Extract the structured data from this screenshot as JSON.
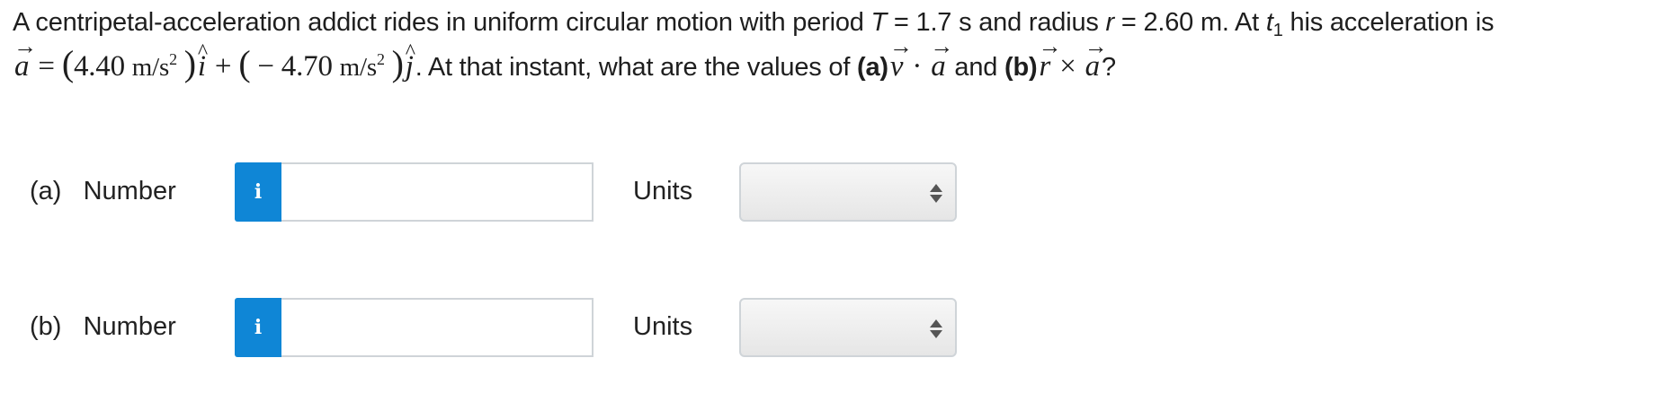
{
  "problem": {
    "text1": "A centripetal-acceleration addict rides in uniform circular motion with period ",
    "period_var": "T",
    "period_value": " = 1.7 s and radius ",
    "radius_var": "r",
    "radius_value": " = 2.60 m. At ",
    "time_var": "t",
    "time_sub": "1",
    "text2": " his acceleration is",
    "accel_vec": "a",
    "eq": " = ",
    "x_comp": "4.40",
    "y_comp": "− 4.70",
    "unit": "m/s",
    "unit_exp": "2",
    "i_hat": "i",
    "j_hat": "j",
    "plus": " + ",
    "question_lead": ". At that instant, what are the values of ",
    "part_a_label": "(a)",
    "v_vec": "v",
    "dot": " · ",
    "and": " and ",
    "part_b_label": "(b)",
    "r_vec": "r",
    "cross": " × ",
    "question_end": "?"
  },
  "answers": [
    {
      "label": "(a)   Number",
      "info_icon": "i",
      "value": "",
      "units_label": "Units",
      "units_selected": ""
    },
    {
      "label": "(b)   Number",
      "info_icon": "i",
      "value": "",
      "units_label": "Units",
      "units_selected": ""
    }
  ],
  "colors": {
    "info_button": "#0f86d6",
    "input_border": "#cfd4d8"
  }
}
